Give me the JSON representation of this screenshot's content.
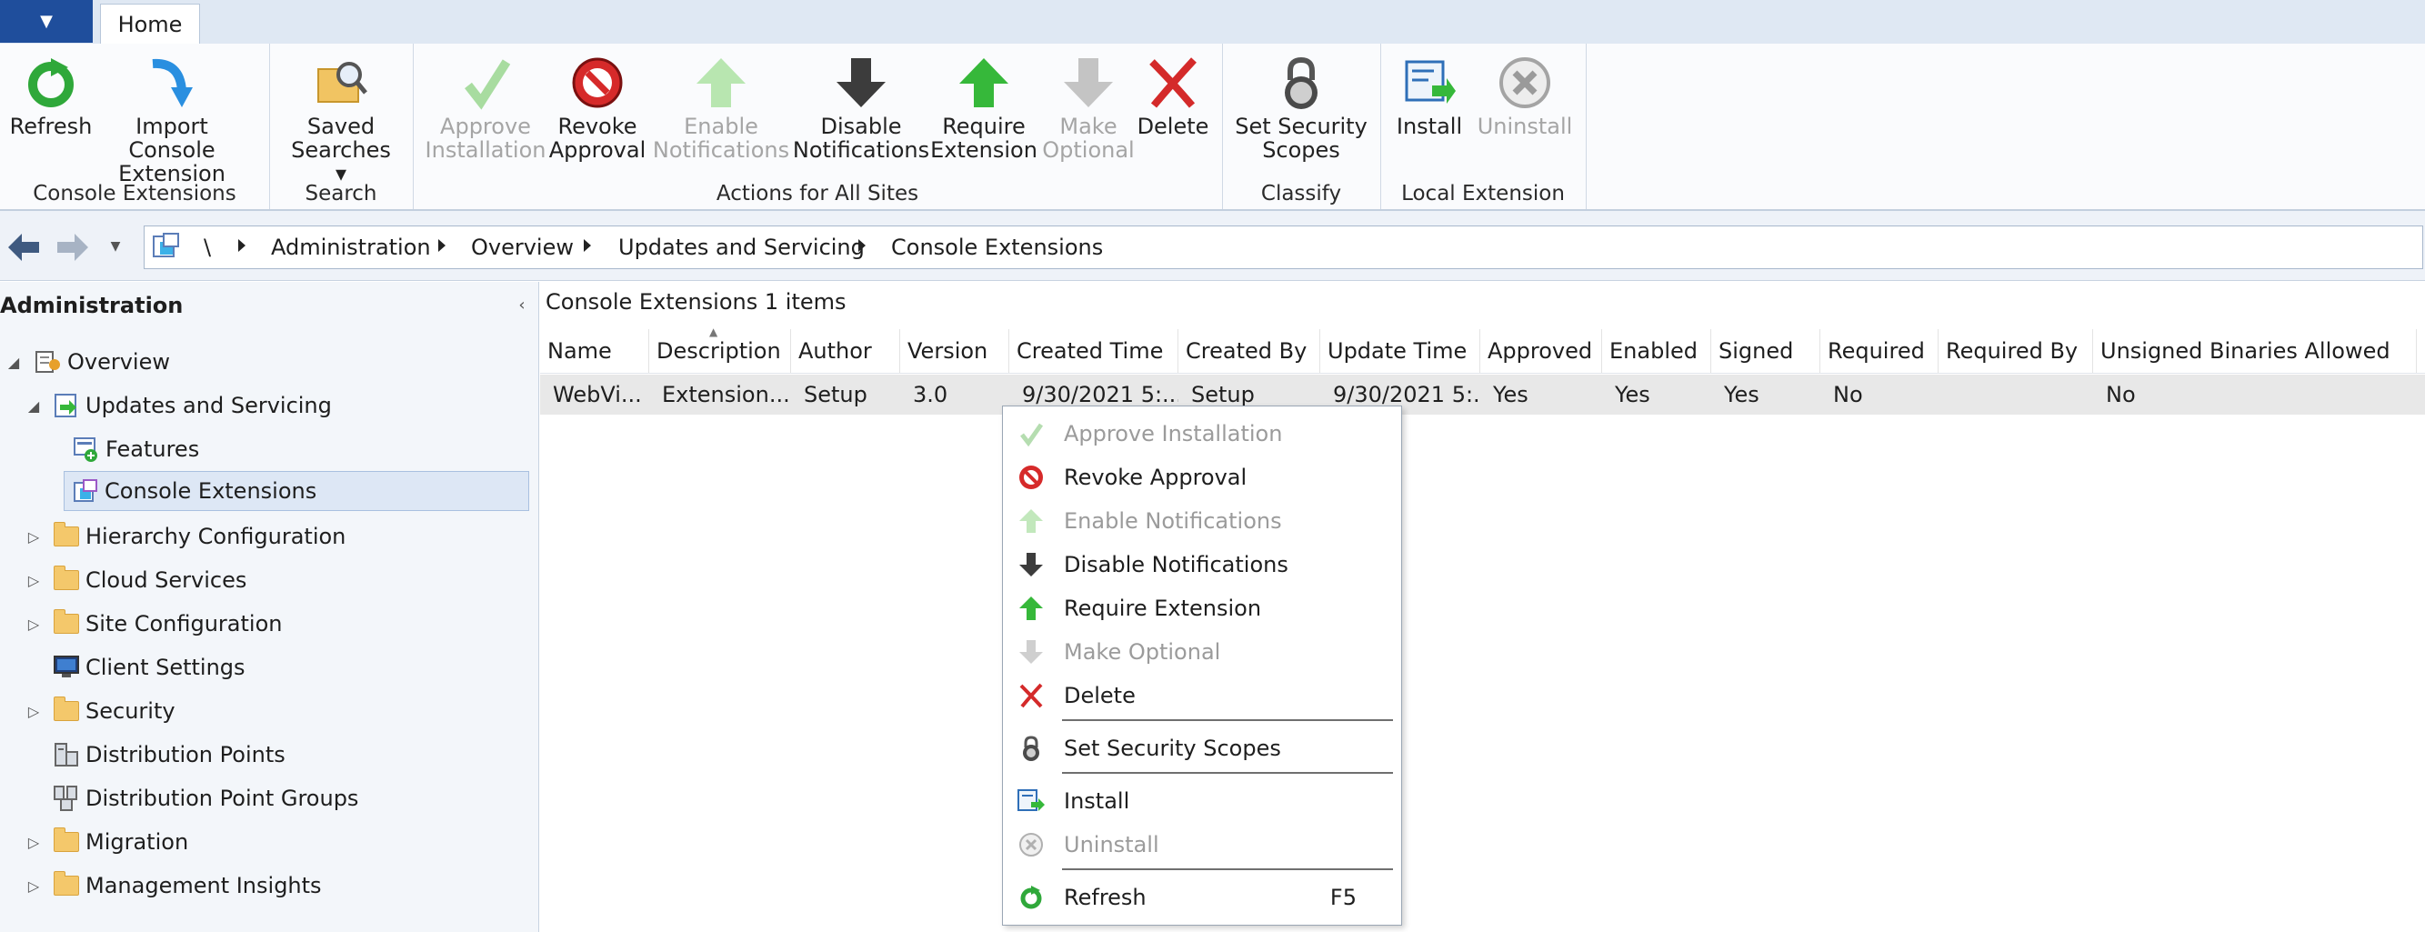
{
  "tabs": {
    "app_menu_icon": "dropdown-arrow",
    "home": "Home"
  },
  "ribbon": {
    "groups": {
      "console_extensions": "Console Extensions",
      "search": "Search",
      "actions_all_sites": "Actions for All Sites",
      "classify": "Classify",
      "local_extension": "Local Extension"
    },
    "buttons": {
      "refresh": "Refresh",
      "import": "Import Console\nExtension",
      "saved_searches": "Saved\nSearches ▾",
      "approve": "Approve\nInstallation",
      "revoke": "Revoke\nApproval",
      "enable_notifications": "Enable\nNotifications",
      "disable_notifications": "Disable\nNotifications",
      "require": "Require\nExtension",
      "make_optional": "Make\nOptional",
      "delete": "Delete",
      "security_scopes": "Set Security\nScopes",
      "install": "Install",
      "uninstall": "Uninstall"
    }
  },
  "address": {
    "root": "\\",
    "crumbs": [
      "Administration",
      "Overview",
      "Updates and Servicing",
      "Console Extensions"
    ]
  },
  "nav": {
    "title": "Administration",
    "items": {
      "overview": "Overview",
      "updates": "Updates and Servicing",
      "features": "Features",
      "console_ext": "Console Extensions",
      "hierarchy": "Hierarchy Configuration",
      "cloud": "Cloud Services",
      "site_config": "Site Configuration",
      "client_settings": "Client Settings",
      "security": "Security",
      "dist_points": "Distribution Points",
      "dist_point_groups": "Distribution Point Groups",
      "migration": "Migration",
      "insights": "Management Insights"
    }
  },
  "main": {
    "title": "Console Extensions",
    "count": "1 items",
    "columns": [
      "Name",
      "Description",
      "Author",
      "Version",
      "Created Time",
      "Created By",
      "Update Time",
      "Approved",
      "Enabled",
      "Signed",
      "Required",
      "Required By",
      "Unsigned Binaries Allowed"
    ],
    "row": [
      "WebVi...",
      "Extension...",
      "Setup",
      "3.0",
      "9/30/2021 5:...",
      "Setup",
      "9/30/2021 5:...",
      "Yes",
      "Yes",
      "Yes",
      "No",
      "",
      "No"
    ]
  },
  "context_menu": {
    "approve": "Approve Installation",
    "revoke": "Revoke Approval",
    "enable": "Enable Notifications",
    "disable": "Disable Notifications",
    "require": "Require Extension",
    "optional": "Make Optional",
    "delete": "Delete",
    "scopes": "Set Security Scopes",
    "install": "Install",
    "uninstall": "Uninstall",
    "refresh": "Refresh",
    "refresh_shortcut": "F5"
  },
  "colors": {
    "accent": "#1f4e9c",
    "green": "#3cb43c",
    "red": "#d42a2a",
    "disabled": "#a5a5a5"
  }
}
